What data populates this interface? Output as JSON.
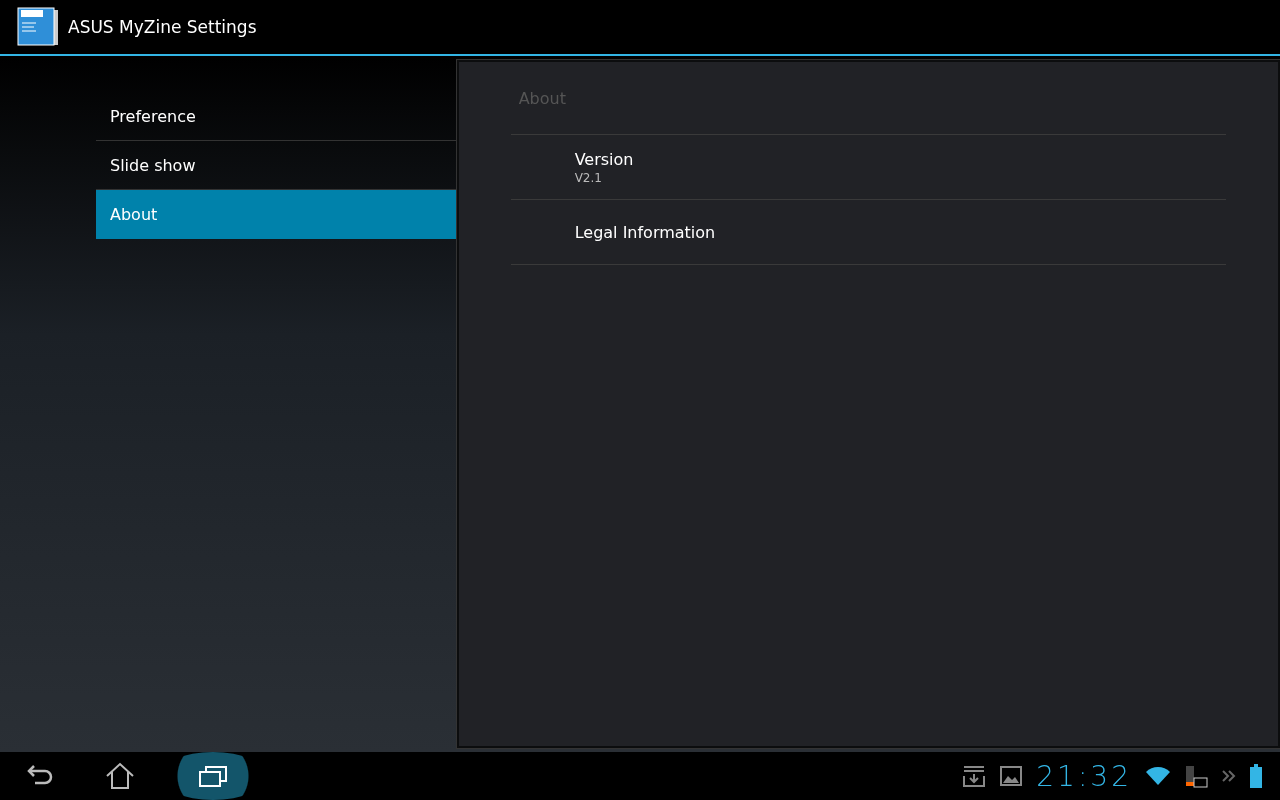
{
  "window": {
    "title": "ASUS MyZine Settings"
  },
  "sidebar": {
    "items": [
      {
        "label": "Preference",
        "selected": false
      },
      {
        "label": "Slide show",
        "selected": false
      },
      {
        "label": "About",
        "selected": true
      }
    ]
  },
  "panel": {
    "title": "About",
    "items": [
      {
        "title": "Version",
        "summary": "V2.1"
      },
      {
        "title": "Legal Information"
      }
    ]
  },
  "status_bar": {
    "time": "21:32",
    "recents_active": true
  }
}
